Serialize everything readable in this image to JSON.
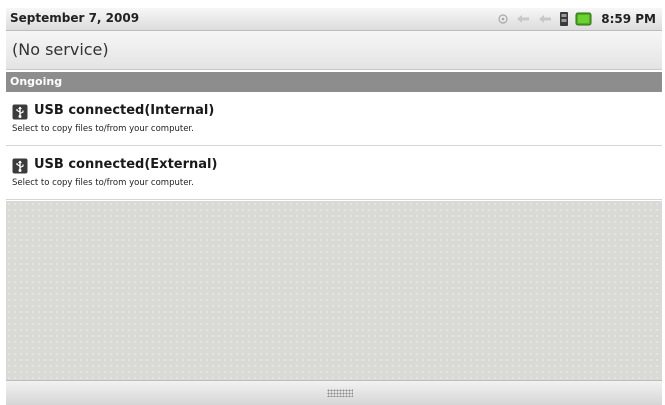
{
  "status_bar": {
    "date": "September 7, 2009",
    "time": "8:59 PM",
    "icons": [
      "usb-icon",
      "signal-arrows-icon",
      "signal-arrows-icon",
      "sd-card-icon",
      "battery-icon"
    ],
    "battery_color": "#4caf1e"
  },
  "service": {
    "text": "(No service)"
  },
  "ongoing": {
    "header": "Ongoing",
    "items": [
      {
        "title": "USB connected(Internal)",
        "subtitle": "Select to copy files to/from your computer.",
        "icon": "usb-notification-icon"
      },
      {
        "title": "USB connected(External)",
        "subtitle": "Select to copy files to/from your computer.",
        "icon": "usb-notification-icon"
      }
    ]
  }
}
